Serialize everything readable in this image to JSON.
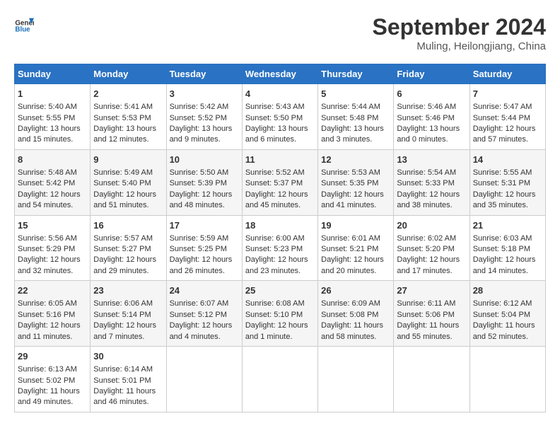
{
  "header": {
    "logo_line1": "General",
    "logo_line2": "Blue",
    "month_year": "September 2024",
    "location": "Muling, Heilongjiang, China"
  },
  "days_of_week": [
    "Sunday",
    "Monday",
    "Tuesday",
    "Wednesday",
    "Thursday",
    "Friday",
    "Saturday"
  ],
  "weeks": [
    [
      {
        "day": 1,
        "sunrise": "5:40 AM",
        "sunset": "5:55 PM",
        "daylight": "13 hours and 15 minutes."
      },
      {
        "day": 2,
        "sunrise": "5:41 AM",
        "sunset": "5:53 PM",
        "daylight": "13 hours and 12 minutes."
      },
      {
        "day": 3,
        "sunrise": "5:42 AM",
        "sunset": "5:52 PM",
        "daylight": "13 hours and 9 minutes."
      },
      {
        "day": 4,
        "sunrise": "5:43 AM",
        "sunset": "5:50 PM",
        "daylight": "13 hours and 6 minutes."
      },
      {
        "day": 5,
        "sunrise": "5:44 AM",
        "sunset": "5:48 PM",
        "daylight": "13 hours and 3 minutes."
      },
      {
        "day": 6,
        "sunrise": "5:46 AM",
        "sunset": "5:46 PM",
        "daylight": "13 hours and 0 minutes."
      },
      {
        "day": 7,
        "sunrise": "5:47 AM",
        "sunset": "5:44 PM",
        "daylight": "12 hours and 57 minutes."
      }
    ],
    [
      {
        "day": 8,
        "sunrise": "5:48 AM",
        "sunset": "5:42 PM",
        "daylight": "12 hours and 54 minutes."
      },
      {
        "day": 9,
        "sunrise": "5:49 AM",
        "sunset": "5:40 PM",
        "daylight": "12 hours and 51 minutes."
      },
      {
        "day": 10,
        "sunrise": "5:50 AM",
        "sunset": "5:39 PM",
        "daylight": "12 hours and 48 minutes."
      },
      {
        "day": 11,
        "sunrise": "5:52 AM",
        "sunset": "5:37 PM",
        "daylight": "12 hours and 45 minutes."
      },
      {
        "day": 12,
        "sunrise": "5:53 AM",
        "sunset": "5:35 PM",
        "daylight": "12 hours and 41 minutes."
      },
      {
        "day": 13,
        "sunrise": "5:54 AM",
        "sunset": "5:33 PM",
        "daylight": "12 hours and 38 minutes."
      },
      {
        "day": 14,
        "sunrise": "5:55 AM",
        "sunset": "5:31 PM",
        "daylight": "12 hours and 35 minutes."
      }
    ],
    [
      {
        "day": 15,
        "sunrise": "5:56 AM",
        "sunset": "5:29 PM",
        "daylight": "12 hours and 32 minutes."
      },
      {
        "day": 16,
        "sunrise": "5:57 AM",
        "sunset": "5:27 PM",
        "daylight": "12 hours and 29 minutes."
      },
      {
        "day": 17,
        "sunrise": "5:59 AM",
        "sunset": "5:25 PM",
        "daylight": "12 hours and 26 minutes."
      },
      {
        "day": 18,
        "sunrise": "6:00 AM",
        "sunset": "5:23 PM",
        "daylight": "12 hours and 23 minutes."
      },
      {
        "day": 19,
        "sunrise": "6:01 AM",
        "sunset": "5:21 PM",
        "daylight": "12 hours and 20 minutes."
      },
      {
        "day": 20,
        "sunrise": "6:02 AM",
        "sunset": "5:20 PM",
        "daylight": "12 hours and 17 minutes."
      },
      {
        "day": 21,
        "sunrise": "6:03 AM",
        "sunset": "5:18 PM",
        "daylight": "12 hours and 14 minutes."
      }
    ],
    [
      {
        "day": 22,
        "sunrise": "6:05 AM",
        "sunset": "5:16 PM",
        "daylight": "12 hours and 11 minutes."
      },
      {
        "day": 23,
        "sunrise": "6:06 AM",
        "sunset": "5:14 PM",
        "daylight": "12 hours and 7 minutes."
      },
      {
        "day": 24,
        "sunrise": "6:07 AM",
        "sunset": "5:12 PM",
        "daylight": "12 hours and 4 minutes."
      },
      {
        "day": 25,
        "sunrise": "6:08 AM",
        "sunset": "5:10 PM",
        "daylight": "12 hours and 1 minute."
      },
      {
        "day": 26,
        "sunrise": "6:09 AM",
        "sunset": "5:08 PM",
        "daylight": "11 hours and 58 minutes."
      },
      {
        "day": 27,
        "sunrise": "6:11 AM",
        "sunset": "5:06 PM",
        "daylight": "11 hours and 55 minutes."
      },
      {
        "day": 28,
        "sunrise": "6:12 AM",
        "sunset": "5:04 PM",
        "daylight": "11 hours and 52 minutes."
      }
    ],
    [
      {
        "day": 29,
        "sunrise": "6:13 AM",
        "sunset": "5:02 PM",
        "daylight": "11 hours and 49 minutes."
      },
      {
        "day": 30,
        "sunrise": "6:14 AM",
        "sunset": "5:01 PM",
        "daylight": "11 hours and 46 minutes."
      },
      null,
      null,
      null,
      null,
      null
    ]
  ]
}
